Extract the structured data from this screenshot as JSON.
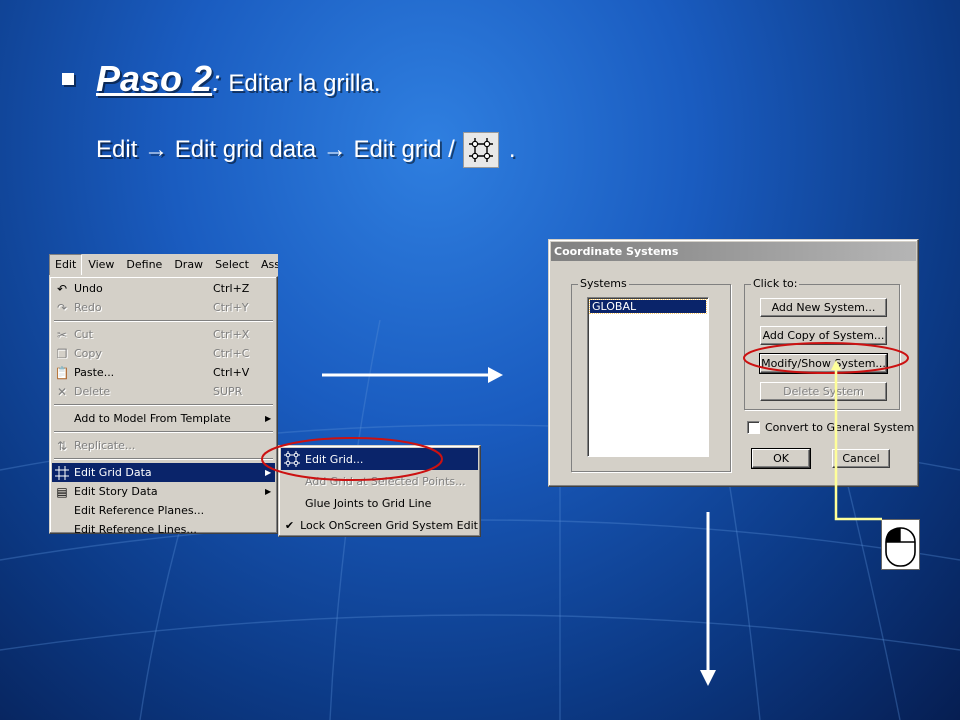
{
  "slide": {
    "step_title": "Paso 2",
    "step_colon": ":",
    "step_desc": "Editar la grilla.",
    "path_text": "Edit → Edit grid data → Edit grid /",
    "path_end": "."
  },
  "menubar": {
    "items": [
      "Edit",
      "View",
      "Define",
      "Draw",
      "Select",
      "Assign"
    ]
  },
  "edit_menu": {
    "undo": {
      "label": "Undo",
      "shortcut": "Ctrl+Z"
    },
    "redo": {
      "label": "Redo",
      "shortcut": "Ctrl+Y"
    },
    "cut": {
      "label": "Cut",
      "shortcut": "Ctrl+X"
    },
    "copy": {
      "label": "Copy",
      "shortcut": "Ctrl+C"
    },
    "paste": {
      "label": "Paste...",
      "shortcut": "Ctrl+V"
    },
    "delete": {
      "label": "Delete",
      "shortcut": "SUPR"
    },
    "add_template": {
      "label": "Add to Model From Template"
    },
    "replicate": {
      "label": "Replicate..."
    },
    "edit_grid_data": {
      "label": "Edit Grid Data"
    },
    "edit_story_data": {
      "label": "Edit Story Data"
    },
    "edit_ref_planes": {
      "label": "Edit Reference Planes..."
    },
    "edit_ref_lines": {
      "label": "Edit Reference Lines..."
    }
  },
  "grid_submenu": {
    "edit_grid": "Edit Grid...",
    "add_grid_points": "Add Grid at Selected Points...",
    "glue_joints": "Glue Joints to Grid Line",
    "lock_grid": "Lock OnScreen Grid System Edit"
  },
  "dialog": {
    "title": "Coordinate Systems",
    "systems_label": "Systems",
    "systems_items": [
      "GLOBAL"
    ],
    "click_to_label": "Click to:",
    "add_new": "Add New System...",
    "add_copy": "Add Copy of System...",
    "modify_show": "Modify/Show System...",
    "delete_system": "Delete System",
    "convert_label": "Convert to General System",
    "ok": "OK",
    "cancel": "Cancel"
  },
  "colors": {
    "highlight_ring": "#cc1111",
    "arrow": "#ffffff",
    "pointer_line": "#ffff99"
  }
}
